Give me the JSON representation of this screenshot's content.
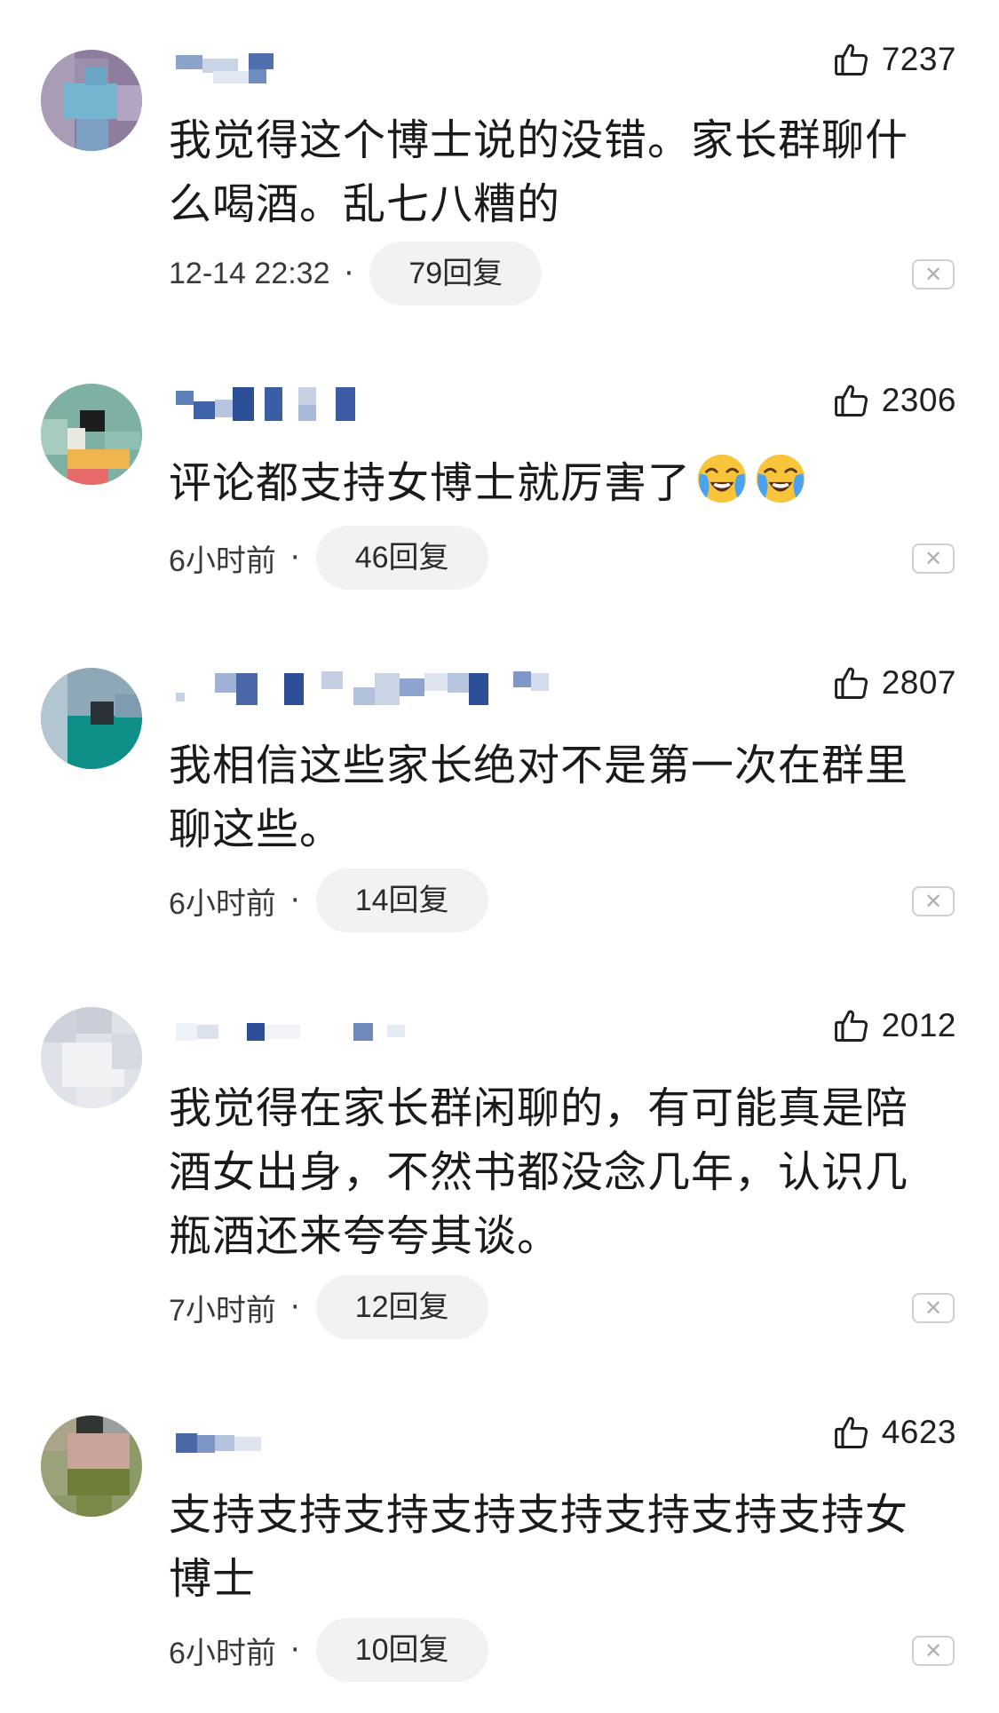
{
  "comments": [
    {
      "likes": "7237",
      "text": "我觉得这个博士说的没错。家长群聊什么喝酒。乱七八糟的",
      "time": "12-14 22:32",
      "replies": "79回复"
    },
    {
      "likes": "2306",
      "text": "评论都支持女博士就厉害了",
      "emoji": [
        "loudly-crying-face-emoji",
        "loudly-crying-face-emoji"
      ],
      "time": "6小时前",
      "replies": "46回复"
    },
    {
      "likes": "2807",
      "text": "我相信这些家长绝对不是第一次在群里聊这些。",
      "time": "6小时前",
      "replies": "14回复"
    },
    {
      "likes": "2012",
      "text": "我觉得在家长群闲聊的，有可能真是陪酒女出身，不然书都没念几年，认识几瓶酒还来夸夸其谈。",
      "time": "7小时前",
      "replies": "12回复"
    },
    {
      "likes": "4623",
      "text": "支持支持支持支持支持支持支持支持女博士",
      "time": "6小时前",
      "replies": "10回复"
    }
  ],
  "separator": "·",
  "icons": {
    "like": "thumbs-up-icon",
    "close": "close-icon"
  }
}
